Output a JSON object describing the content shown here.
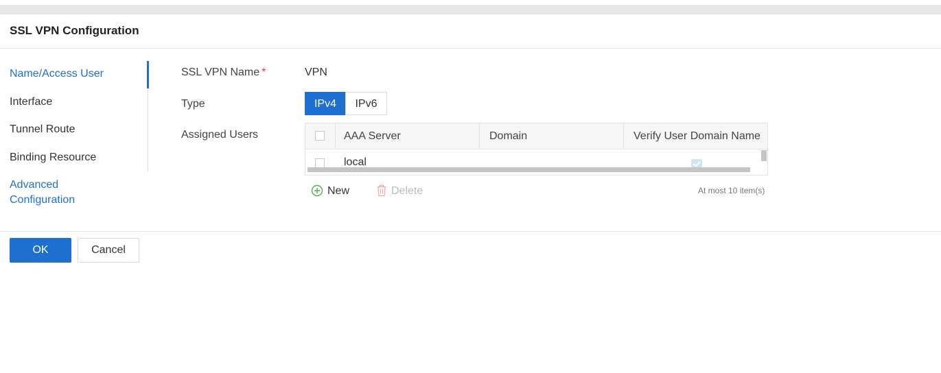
{
  "dialog": {
    "title": "SSL VPN Configuration"
  },
  "nav": {
    "items": [
      {
        "label": "Name/Access User",
        "active": true
      },
      {
        "label": "Interface",
        "active": false
      },
      {
        "label": "Tunnel Route",
        "active": false
      },
      {
        "label": "Binding Resource",
        "active": false
      }
    ],
    "advanced": {
      "line1": "Advanced",
      "line2": "Configuration"
    }
  },
  "form": {
    "name": {
      "label": "SSL VPN Name",
      "required_mark": "*",
      "value": "VPN"
    },
    "type": {
      "label": "Type",
      "options": [
        "IPv4",
        "IPv6"
      ],
      "selected": "IPv4"
    },
    "users": {
      "label": "Assigned Users",
      "columns": [
        "AAA Server",
        "Domain",
        "Verify User Domain Name"
      ],
      "rows": [
        {
          "aaa_server": "local",
          "domain": "",
          "verify": true
        }
      ],
      "new_label": "New",
      "delete_label": "Delete",
      "limit_text": "At most 10 item(s)"
    }
  },
  "footer": {
    "ok": "OK",
    "cancel": "Cancel"
  },
  "colors": {
    "accent": "#1e6fd0",
    "required": "#e5393b",
    "add_icon": "#4caf50",
    "delete_icon": "#f2a5a5"
  }
}
